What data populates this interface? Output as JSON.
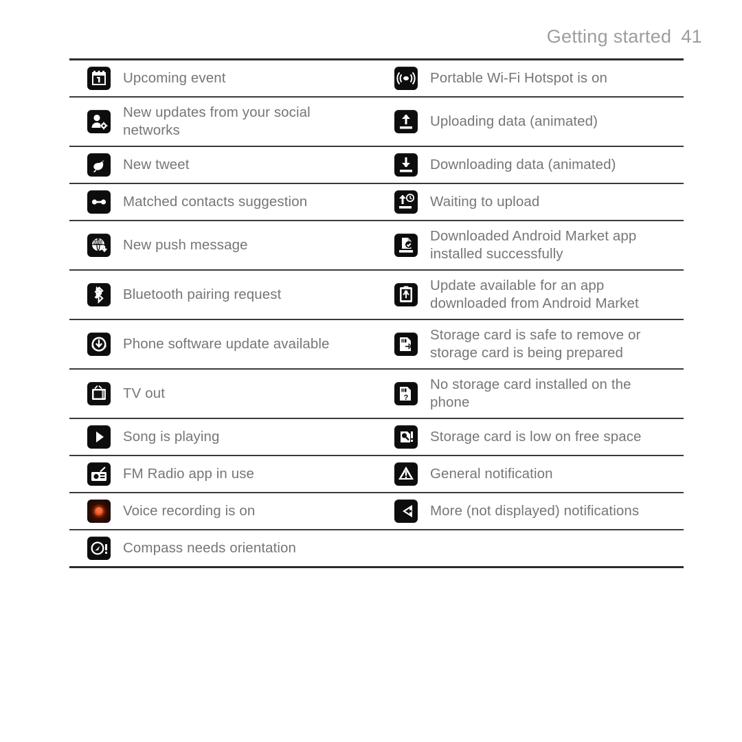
{
  "header": {
    "title": "Getting started",
    "page_number": "41"
  },
  "table": {
    "rows": [
      {
        "left": {
          "icon": "calendar-icon",
          "label": "Upcoming event"
        },
        "right": {
          "icon": "wifi-hotspot-icon",
          "label": "Portable Wi-Fi Hotspot is on"
        }
      },
      {
        "left": {
          "icon": "social-updates-icon",
          "label": "New updates from your social\nnetworks"
        },
        "right": {
          "icon": "upload-data-icon",
          "label": "Uploading data (animated)"
        }
      },
      {
        "left": {
          "icon": "twitter-bird-icon",
          "label": "New tweet"
        },
        "right": {
          "icon": "download-data-icon",
          "label": "Downloading data (animated)"
        }
      },
      {
        "left": {
          "icon": "matched-contacts-icon",
          "label": "Matched contacts suggestion"
        },
        "right": {
          "icon": "waiting-upload-icon",
          "label": "Waiting to upload"
        }
      },
      {
        "left": {
          "icon": "push-message-icon",
          "label": "New push message"
        },
        "right": {
          "icon": "market-installed-icon",
          "label": "Downloaded Android Market app\ninstalled successfully"
        }
      },
      {
        "left": {
          "icon": "bluetooth-icon",
          "label": "Bluetooth pairing request"
        },
        "right": {
          "icon": "market-update-icon",
          "label": "Update available for an app\ndownloaded from Android Market"
        }
      },
      {
        "left": {
          "icon": "software-update-icon",
          "label": "Phone software update available"
        },
        "right": {
          "icon": "storage-safe-remove-icon",
          "label": "Storage card is safe to remove or\nstorage card is being prepared"
        }
      },
      {
        "left": {
          "icon": "tv-out-icon",
          "label": "TV out"
        },
        "right": {
          "icon": "no-storage-card-icon",
          "label": "No storage card installed on the\nphone"
        }
      },
      {
        "left": {
          "icon": "music-playing-icon",
          "label": "Song is playing"
        },
        "right": {
          "icon": "storage-low-space-icon",
          "label": "Storage card is low on free space"
        }
      },
      {
        "left": {
          "icon": "fm-radio-icon",
          "label": "FM Radio app in use"
        },
        "right": {
          "icon": "general-notification-icon",
          "label": "General notification"
        }
      },
      {
        "left": {
          "icon": "voice-recording-icon",
          "label": "Voice recording is on"
        },
        "right": {
          "icon": "more-notifications-icon",
          "label": "More (not displayed) notifications"
        }
      },
      {
        "left": {
          "icon": "compass-icon",
          "label": "Compass needs orientation"
        },
        "right": null
      }
    ]
  },
  "colors": {
    "text": "#767676",
    "header_text": "#9d9d9d",
    "rule": "#2b2b2b",
    "icon_background": "#0d0d0d",
    "recording_accent": "#e8481c"
  }
}
